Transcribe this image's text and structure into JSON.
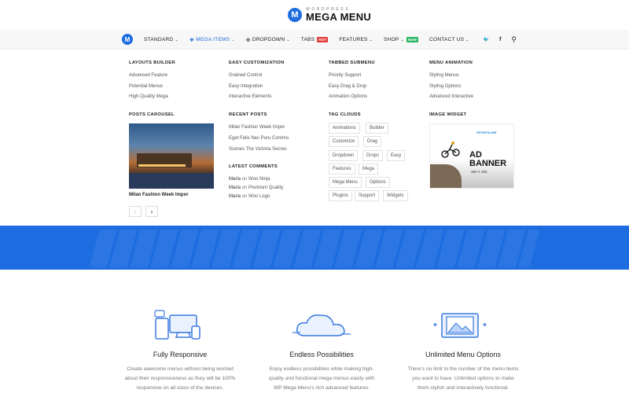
{
  "logo": {
    "small": "WORDPRESS",
    "big": "MEGA MENU",
    "badge": "M"
  },
  "nav": {
    "badge": "M",
    "items": [
      {
        "label": "STANDARD",
        "chev": "⌄"
      },
      {
        "label": "MEGA ITEMS",
        "chev": "⌄",
        "icon": "❖"
      },
      {
        "label": "DROPDOWN",
        "chev": "⌄",
        "icon": "⊕"
      },
      {
        "label": "TABS",
        "badge": "HOT"
      },
      {
        "label": "FEATURES",
        "chev": "⌄"
      },
      {
        "label": "SHOP",
        "chev": "⌄",
        "badge": "NEW"
      },
      {
        "label": "CONTACT US",
        "chev": "⌄"
      }
    ],
    "right": {
      "twitter": "🐦",
      "facebook": "f",
      "search": "⚲"
    }
  },
  "mega": {
    "layouts_builder": {
      "title": "LAYOUTS BUILDER",
      "links": [
        "Advanced Feature",
        "Potential Menus",
        "High-Quality Mega"
      ]
    },
    "easy_customization": {
      "title": "EASY CUSTOMIZATION",
      "links": [
        "Grained Control",
        "Easy Integration",
        "Interactive Elements"
      ]
    },
    "tabbed_submenu": {
      "title": "TABBED SUBMENU",
      "links": [
        "Priority Support",
        "Easy Drag & Drop",
        "Animation Options"
      ]
    },
    "menu_animation": {
      "title": "MENU ANIMATION",
      "links": [
        "Styling Menus",
        "Styling Options",
        "Advanced Interactive"
      ]
    },
    "posts_carousel": {
      "title": "POSTS CAROUSEL",
      "caption": "Milan Fashion Week Impor",
      "prev": "‹",
      "next": "›"
    },
    "recent_posts": {
      "title": "RECENT POSTS",
      "links": [
        "Milan Fashion Week Impor",
        "Eget Felis Nec Puru Commo",
        "Scenes The Victoria Secrec"
      ]
    },
    "latest_comments": {
      "title": "LATEST COMMENTS",
      "items": [
        {
          "author": "Maria",
          "on": "on",
          "post": "Woo Ninja"
        },
        {
          "author": "Maria",
          "on": "on",
          "post": "Premium Quality"
        },
        {
          "author": "Maria",
          "on": "on",
          "post": "Woo Logo"
        }
      ]
    },
    "tag_clouds": {
      "title": "TAG CLOUDS",
      "tags": [
        "Animations",
        "Builder",
        "Customize",
        "Drag",
        "Dropdown",
        "Drops",
        "Easy",
        "Features",
        "Mega",
        "Mega Menu",
        "Options",
        "Plugins",
        "Support",
        "Widgets"
      ]
    },
    "image_widget": {
      "title": "IMAGE WIDGET",
      "brand": "SPORTSLINE",
      "line1": "AD",
      "line2": "BANNER",
      "size": "360 X 260"
    }
  },
  "features": [
    {
      "title": "Fully Responsive",
      "desc": [
        "Create awesome menus without being worried",
        "about their responsiveness as they will be 100%",
        "responsive on all sizes of the devices."
      ],
      "icon": "devices-icon"
    },
    {
      "title": "Endless Possibilities",
      "desc": [
        "Enjoy endless possibilities while making high-",
        "quality and functional mega menus easily with",
        "WP Mega Menu's rich advanced features."
      ],
      "icon": "cloud-icon"
    },
    {
      "title": "Unlimited Menu Options",
      "desc": [
        "There's no limit to the number of the menu items",
        "you want to have. Unlimited options to make",
        "them stylish and interactively functional."
      ],
      "icon": "gallery-icon"
    }
  ],
  "colors": {
    "accent": "#1e6de0",
    "hot": "#e33b3b",
    "new": "#28b463"
  }
}
